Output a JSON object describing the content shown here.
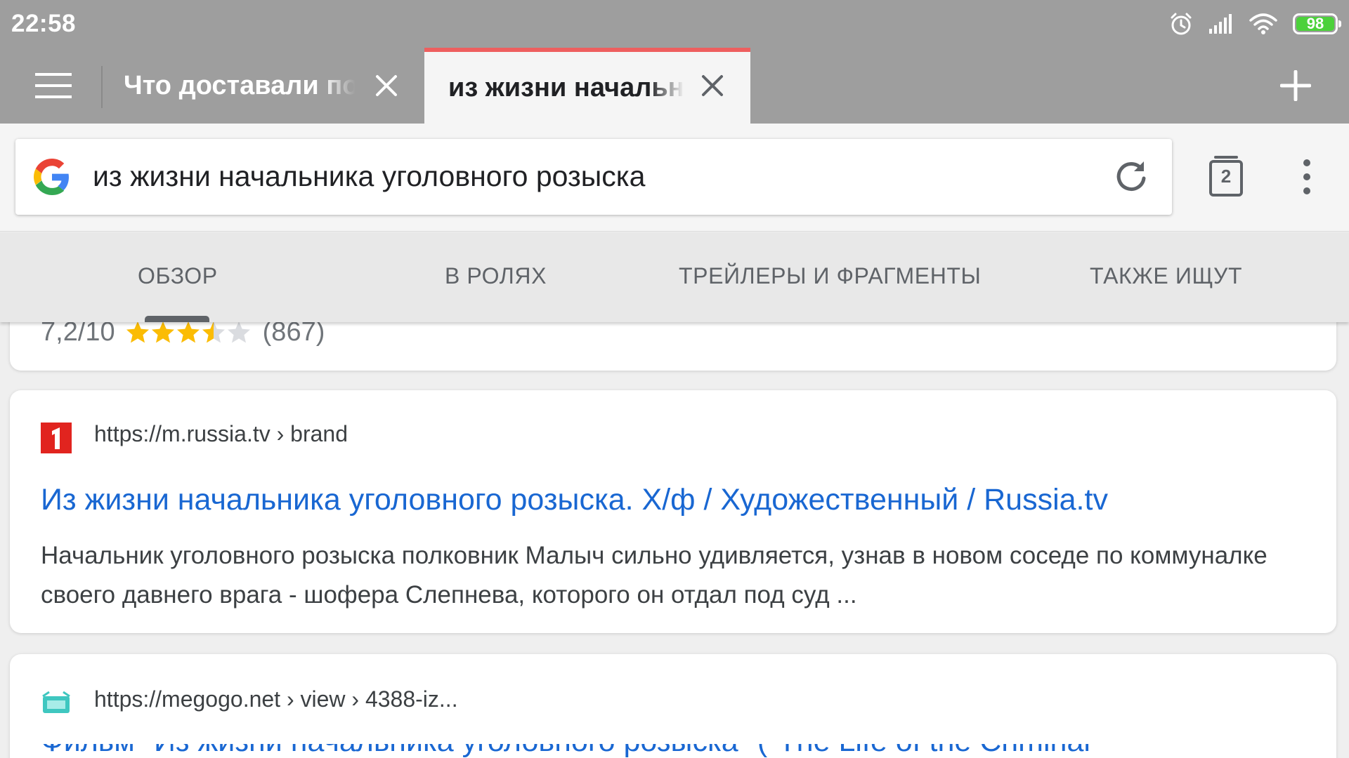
{
  "status_bar": {
    "time": "22:58",
    "battery": "98",
    "icons": [
      "alarm-icon",
      "signal-icon",
      "wifi-icon",
      "battery-icon"
    ]
  },
  "tabs": [
    {
      "title": "Что доставали по",
      "active": false
    },
    {
      "title": "из жизни начальника",
      "active": true
    }
  ],
  "toolbar": {
    "query": "из жизни начальника уголовного розыска",
    "tab_count": "2"
  },
  "search_tabs": [
    "ОБЗОР",
    "В РОЛЯХ",
    "ТРЕЙЛЕРЫ И ФРАГМЕНТЫ",
    "ТАКЖЕ ИЩУТ"
  ],
  "rating": {
    "score": "7,2/10",
    "stars_filled": 3.5,
    "stars_total": 5,
    "count": "(867)"
  },
  "results": [
    {
      "url": "https://m.russia.tv › brand",
      "title": "Из жизни начальника уголовного розыска. Х/ф / Художественный / Russia.tv",
      "snippet": "Начальник уголовного розыска полковник Малыч сильно удивляется, узнав в новом соседе по коммуналке своего давнего врага - шофера Слепнева, которого он отдал под суд ..."
    },
    {
      "url": "https://megogo.net › view › 4388-iz...",
      "title": "Фильм \"Из жизни начальника уголовного розыска\" (\"The Life of the Criminal"
    }
  ],
  "colors": {
    "chrome_gray": "#9e9e9e",
    "active_tab_accent": "#ee5f5f",
    "link_blue": "#1967d2",
    "star_gold": "#fbbc04",
    "battery_green": "#4cd13b"
  }
}
